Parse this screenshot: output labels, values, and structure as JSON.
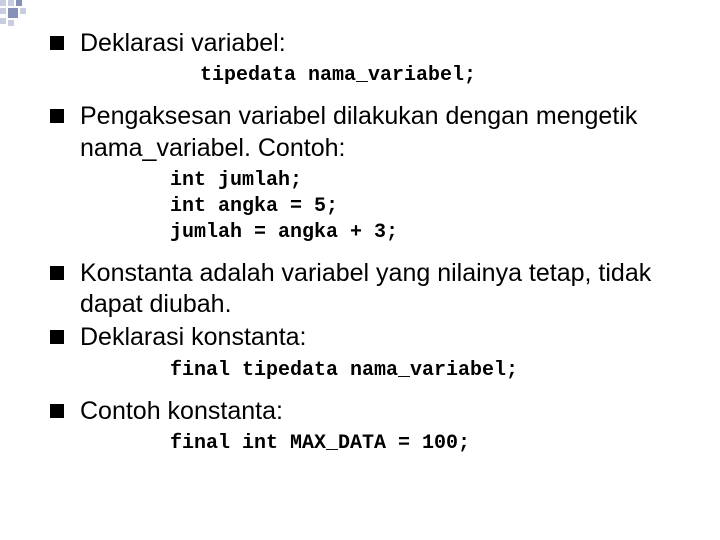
{
  "items": [
    {
      "text": "Deklarasi variabel:"
    },
    {
      "text": "Pengaksesan variabel dilakukan dengan mengetik nama_variabel. Contoh:"
    },
    {
      "text": "Konstanta adalah variabel yang nilainya tetap, tidak dapat diubah."
    },
    {
      "text": "Deklarasi konstanta:"
    },
    {
      "text": "Contoh konstanta:"
    }
  ],
  "code": {
    "c1": "tipedata nama_variabel;",
    "c2": "int jumlah;\nint angka = 5;\njumlah = angka + 3;",
    "c3": "final tipedata nama_variabel;",
    "c4": "final int MAX_DATA = 100;"
  }
}
